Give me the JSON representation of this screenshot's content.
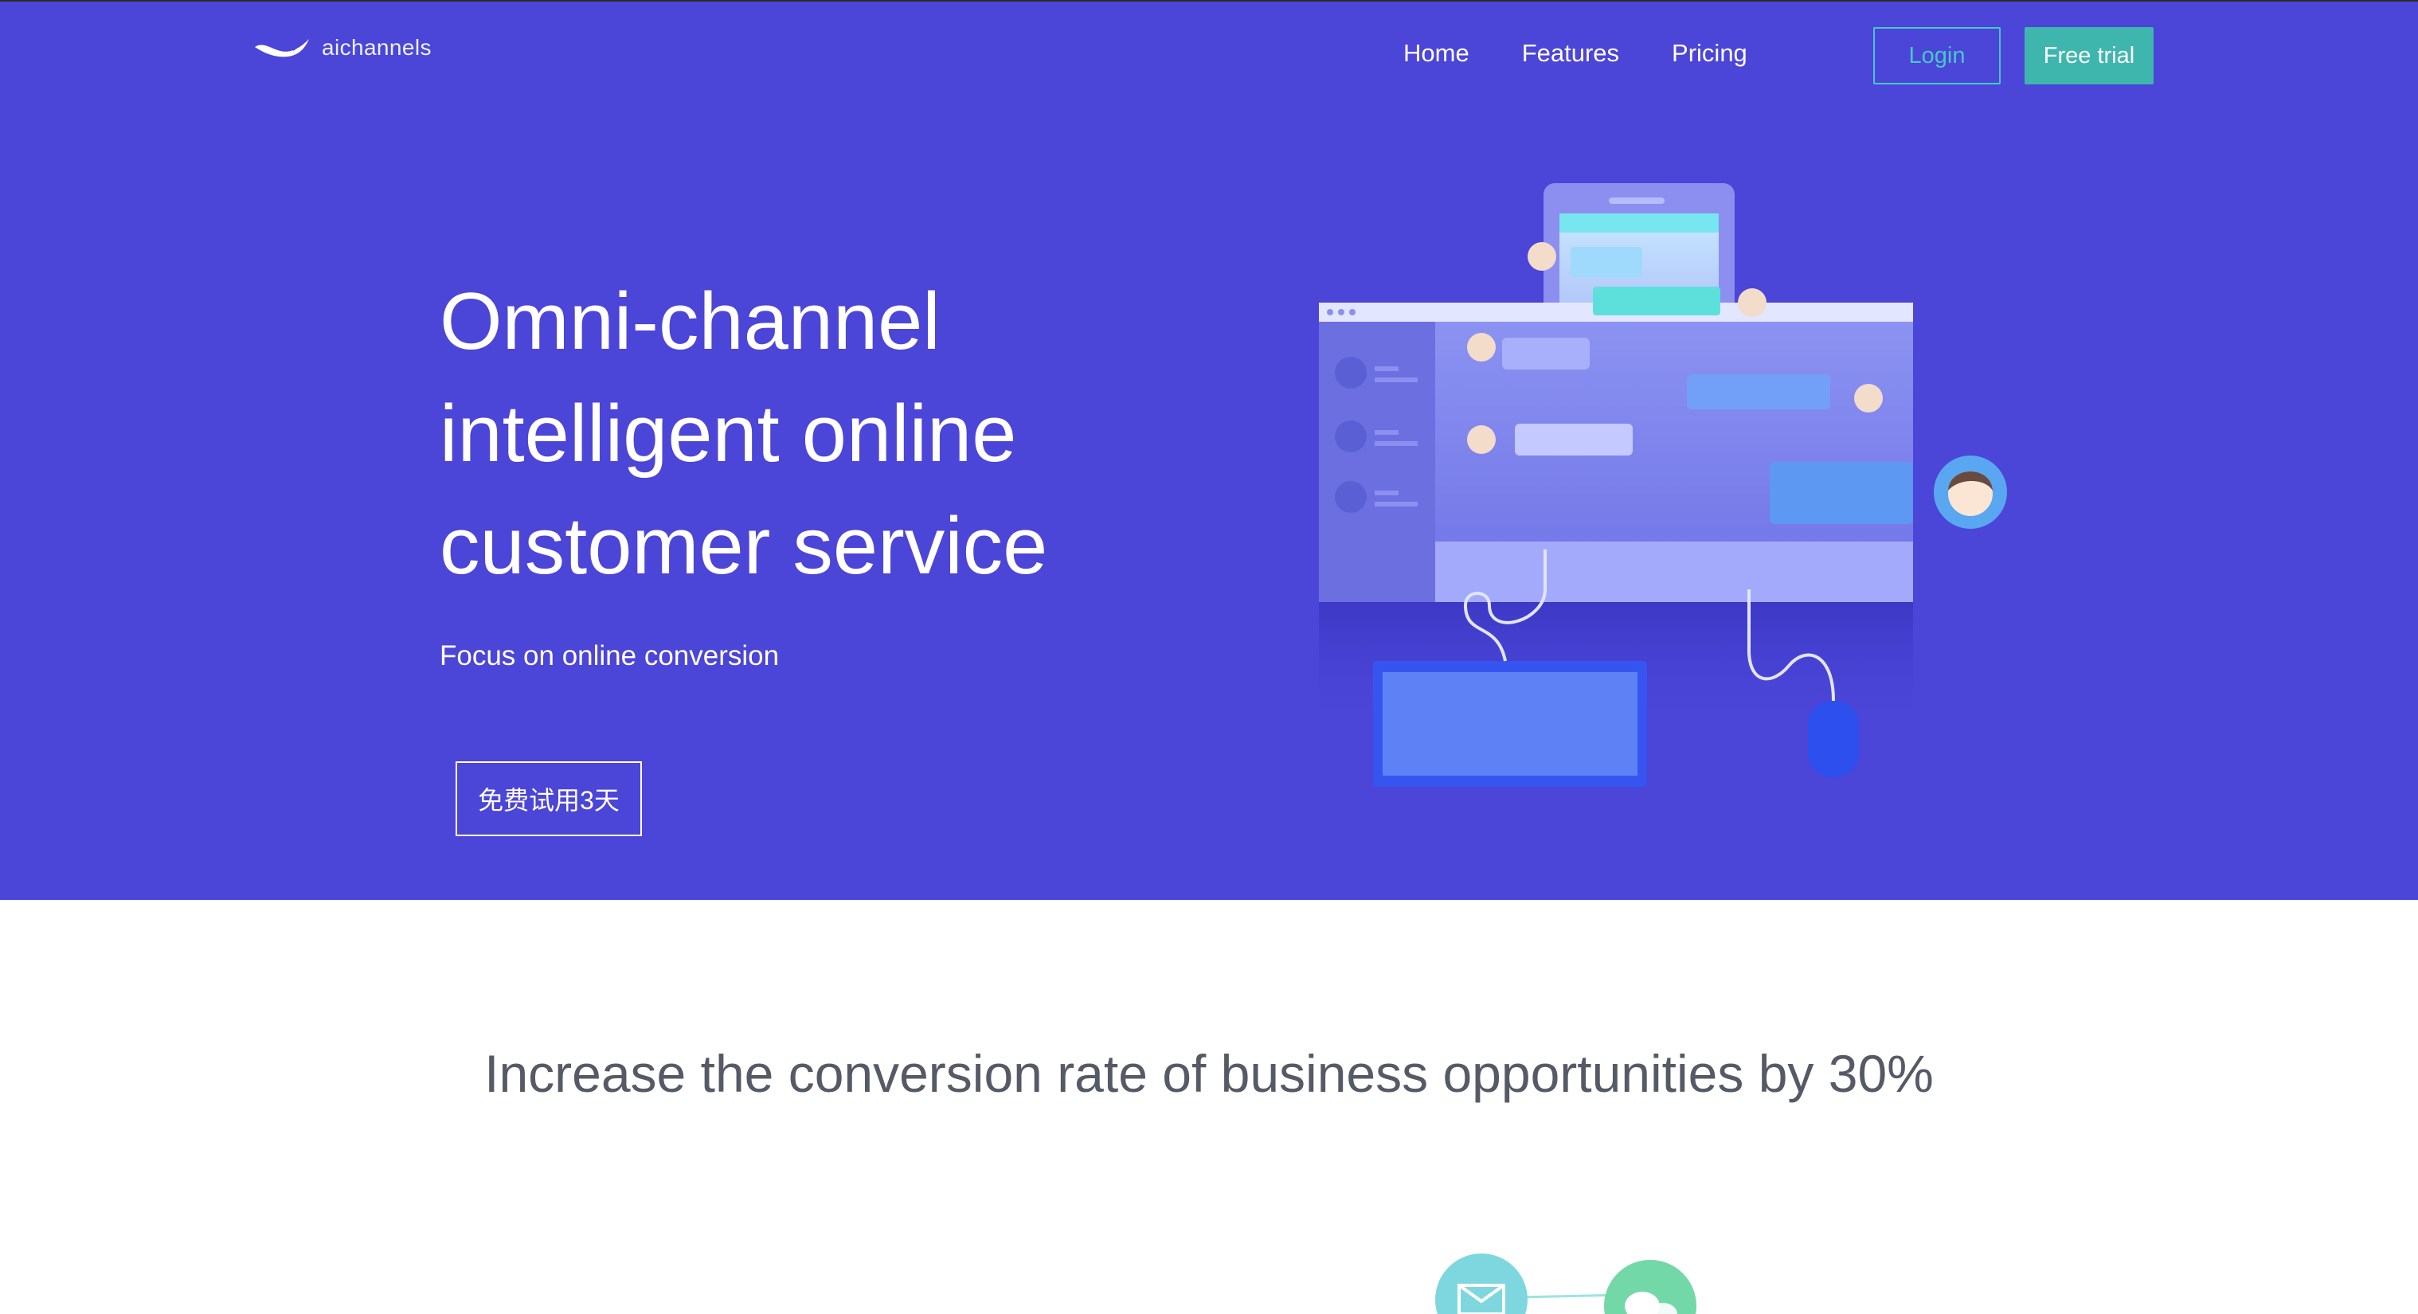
{
  "brand": {
    "name": "aichannels",
    "logo_icon": "whale-icon"
  },
  "nav": {
    "items": [
      {
        "label": "Home"
      },
      {
        "label": "Features"
      },
      {
        "label": "Pricing"
      }
    ],
    "login_label": "Login",
    "trial_label": "Free trial"
  },
  "hero": {
    "title_line1": "Omni-channel",
    "title_line2": "intelligent online",
    "title_line3": "customer service",
    "subtitle": "Focus on online conversion",
    "cta_label": "免费试用3天",
    "background_color": "#4b45d8",
    "illustration_icon": "desktop-chat-illustration"
  },
  "section": {
    "headline": "Increase the conversion rate of business opportunities by 30%",
    "icons": [
      "email-icon",
      "wechat-icon"
    ]
  },
  "colors": {
    "accent_teal": "#3fb6ad",
    "login_outline": "#47c7c9",
    "headline_gray": "#555a66"
  }
}
